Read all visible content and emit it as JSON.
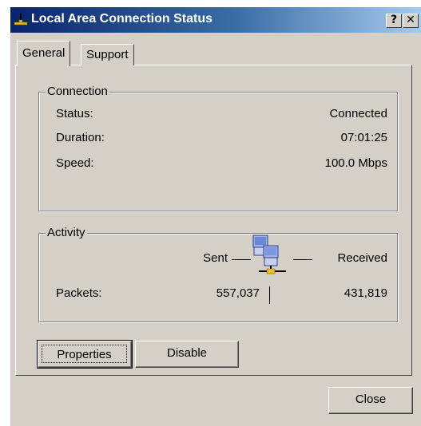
{
  "window": {
    "title": "Local Area Connection Status",
    "help_label": "?",
    "close_label": "✕"
  },
  "tabs": [
    {
      "label": "General",
      "active": true
    },
    {
      "label": "Support",
      "active": false
    }
  ],
  "connection": {
    "group_label": "Connection",
    "status_label": "Status:",
    "status_value": "Connected",
    "duration_label": "Duration:",
    "duration_value": "07:01:25",
    "speed_label": "Speed:",
    "speed_value": "100.0 Mbps"
  },
  "activity": {
    "group_label": "Activity",
    "sent_label": "Sent",
    "received_label": "Received",
    "packets_label": "Packets:",
    "packets_sent": "557,037",
    "packets_received": "431,819"
  },
  "buttons": {
    "properties": "Properties",
    "disable": "Disable",
    "close": "Close"
  },
  "icons": {
    "title": "network-connection-icon",
    "activity": "network-computers-icon"
  },
  "colors": {
    "face": "#d4d0c8",
    "titlebar_start": "#0a246a",
    "titlebar_end": "#a6caf0"
  }
}
